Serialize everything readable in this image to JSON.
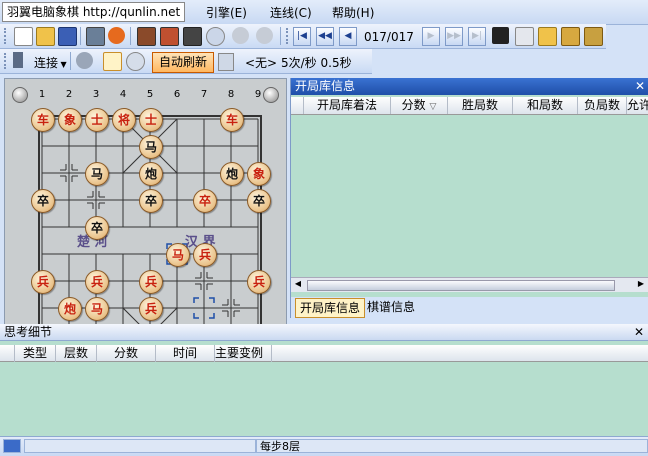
{
  "app": {
    "title": "羽翼电脑象棋 http://qunlin.net",
    "menu": [
      "引擎(E)",
      "连线(C)",
      "帮助(H)"
    ]
  },
  "nav": {
    "move_count": "017/017"
  },
  "toolbar2": {
    "connect_label": "连接",
    "auto_refresh_label": "自动刷新",
    "engine_none": "<无>",
    "speed_text": "5次/秒 0.5秒"
  },
  "board": {
    "file_numbers": [
      "1",
      "2",
      "3",
      "4",
      "5",
      "6",
      "7",
      "8",
      "9"
    ],
    "river_left": "楚 河",
    "river_right": "汉 界",
    "pieces": [
      {
        "c": 0,
        "r": 0,
        "ch": "车",
        "side": "red"
      },
      {
        "c": 1,
        "r": 0,
        "ch": "象",
        "side": "red"
      },
      {
        "c": 2,
        "r": 0,
        "ch": "士",
        "side": "red"
      },
      {
        "c": 3,
        "r": 0,
        "ch": "将",
        "side": "red"
      },
      {
        "c": 4,
        "r": 0,
        "ch": "士",
        "side": "red"
      },
      {
        "c": 7,
        "r": 0,
        "ch": "车",
        "side": "red"
      },
      {
        "c": 4,
        "r": 1,
        "ch": "马",
        "side": "black"
      },
      {
        "c": 2,
        "r": 2,
        "ch": "马",
        "side": "black"
      },
      {
        "c": 4,
        "r": 2,
        "ch": "炮",
        "side": "black"
      },
      {
        "c": 7,
        "r": 2,
        "ch": "炮",
        "side": "black"
      },
      {
        "c": 8,
        "r": 2,
        "ch": "象",
        "side": "red"
      },
      {
        "c": 0,
        "r": 3,
        "ch": "卒",
        "side": "black"
      },
      {
        "c": 4,
        "r": 3,
        "ch": "卒",
        "side": "black"
      },
      {
        "c": 6,
        "r": 3,
        "ch": "卒",
        "side": "red"
      },
      {
        "c": 8,
        "r": 3,
        "ch": "卒",
        "side": "black"
      },
      {
        "c": 2,
        "r": 4,
        "ch": "卒",
        "side": "black"
      },
      {
        "c": 5,
        "r": 5,
        "ch": "马",
        "side": "red"
      },
      {
        "c": 6,
        "r": 5,
        "ch": "兵",
        "side": "red"
      },
      {
        "c": 0,
        "r": 6,
        "ch": "兵",
        "side": "red"
      },
      {
        "c": 2,
        "r": 6,
        "ch": "兵",
        "side": "red"
      },
      {
        "c": 4,
        "r": 6,
        "ch": "兵",
        "side": "red"
      },
      {
        "c": 8,
        "r": 6,
        "ch": "兵",
        "side": "red"
      },
      {
        "c": 1,
        "r": 7,
        "ch": "炮",
        "side": "red"
      },
      {
        "c": 2,
        "r": 7,
        "ch": "马",
        "side": "red"
      },
      {
        "c": 4,
        "r": 7,
        "ch": "兵",
        "side": "red"
      }
    ]
  },
  "opening_panel": {
    "title": "开局库信息",
    "columns": [
      "开局库着法",
      "分数",
      "胜局数",
      "和局数",
      "负局数",
      "允许"
    ],
    "sort_indicator": "▽",
    "tabs": [
      "开局库信息",
      "棋谱信息"
    ]
  },
  "think_panel": {
    "title": "思考细节",
    "columns": [
      "类型",
      "层数",
      "分数",
      "时间",
      "主要变例"
    ]
  },
  "status": {
    "depth_text": "每步8层"
  }
}
